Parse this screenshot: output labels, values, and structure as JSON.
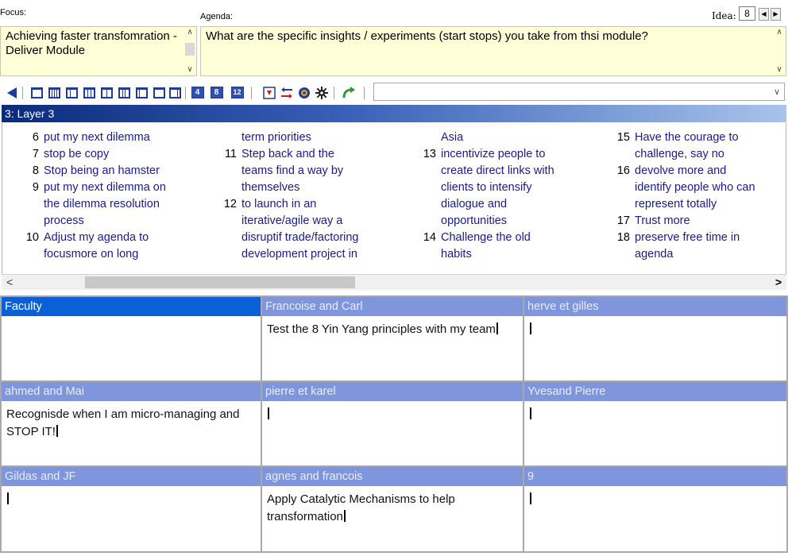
{
  "labels": {
    "focus": "Focus:",
    "agenda": "Agenda:",
    "idea": "Idea:"
  },
  "focus_text": "Achieving faster transfomration - Deliver Module",
  "agenda_text": "What are the specific insights / experiments (start stops) you take from thsi module?",
  "idea_value": "8",
  "toolbar": {
    "num_4": "4",
    "num_8": "8",
    "num_12": "12",
    "combo_value": ""
  },
  "layer_title": "3: Layer 3",
  "list_columns": [
    [
      {
        "num": "6",
        "lines": [
          "put my next dilemma"
        ]
      },
      {
        "num": "7",
        "lines": [
          "stop be copy"
        ]
      },
      {
        "num": "8",
        "lines": [
          "Stop being an hamster"
        ]
      },
      {
        "num": "9",
        "lines": [
          "put my next dilemma on",
          "the dilemma resolution",
          "process"
        ]
      },
      {
        "num": "10",
        "lines": [
          "Adjust my agenda to",
          "focusmore on long"
        ]
      }
    ],
    [
      {
        "num": "",
        "lines": [
          "term priorities"
        ]
      },
      {
        "num": "11",
        "lines": [
          "Step back and the",
          "teams find a way by",
          "themselves"
        ]
      },
      {
        "num": "12",
        "lines": [
          "to launch in an",
          "iterative/agile way a",
          "disruptif trade/factoring",
          "development project in"
        ]
      }
    ],
    [
      {
        "num": "",
        "lines": [
          "Asia"
        ]
      },
      {
        "num": "13",
        "lines": [
          "incentivize people to",
          "create direct links with",
          "clients to intensify",
          "dialogue and",
          "opportunities"
        ]
      },
      {
        "num": "14",
        "lines": [
          "Challenge the old",
          "habits"
        ]
      }
    ],
    [
      {
        "num": "15",
        "lines": [
          "Have the courage to",
          "challenge, say no"
        ]
      },
      {
        "num": "16",
        "lines": [
          "devolve more and",
          "identify people who can",
          "represent totally"
        ]
      },
      {
        "num": "17",
        "lines": [
          "Trust more"
        ]
      },
      {
        "num": "18",
        "lines": [
          "preserve free time in",
          "agenda"
        ]
      }
    ]
  ],
  "grid_cells": [
    {
      "title": "Faculty",
      "text": "",
      "caret": false,
      "selected": true
    },
    {
      "title": "Francoise and Carl",
      "text": "Test the 8 Yin Yang principles with my team",
      "caret": true,
      "selected": false
    },
    {
      "title": "herve et gilles",
      "text": "",
      "caret": true,
      "selected": false
    },
    {
      "title": "ahmed and Mai",
      "text": "Recognisde when I am micro-managing and STOP IT!",
      "caret": true,
      "selected": false
    },
    {
      "title": "pierre et karel",
      "text": "",
      "caret": true,
      "selected": false
    },
    {
      "title": "Yvesand Pierre",
      "text": "",
      "caret": true,
      "selected": false
    },
    {
      "title": "Gildas and JF",
      "text": "",
      "caret": true,
      "selected": false
    },
    {
      "title": "agnes and francois",
      "text": "Apply Catalytic Mechanisms to help transformation",
      "caret": true,
      "selected": false
    },
    {
      "title": "9",
      "text": "",
      "caret": true,
      "selected": false
    }
  ],
  "colors": {
    "memo_bg": "#ffffd8",
    "layer_bar_start": "#0a2a7c",
    "cell_header": "#8096dc",
    "cell_header_selected": "#0a60d6",
    "list_text": "#1a1a8c"
  }
}
